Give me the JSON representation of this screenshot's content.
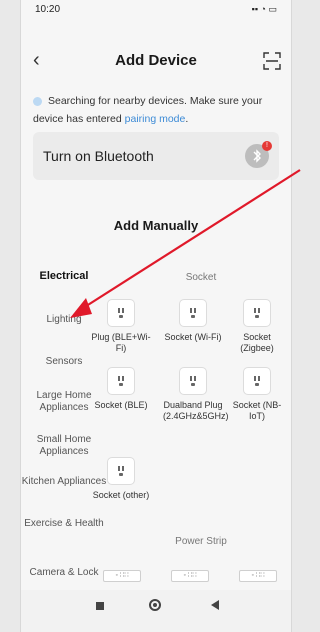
{
  "status": {
    "time": "10:20",
    "right": "▪▪ ◔ ▭"
  },
  "header": {
    "title": "Add Device",
    "back_icon": "chevron-left-icon",
    "scan_icon": "scan-icon"
  },
  "searching": {
    "text": "Searching for nearby devices. Make sure your device has entered",
    "link": "pairing mode",
    "suffix": "."
  },
  "bluetooth": {
    "label": "Turn on Bluetooth",
    "badge": "!"
  },
  "manual": {
    "title": "Add Manually"
  },
  "categories": [
    {
      "label": "Electrical",
      "active": true
    },
    {
      "label": "Lighting"
    },
    {
      "label": "Sensors"
    },
    {
      "label": "Large Home Appliances"
    },
    {
      "label": "Small Home Appliances"
    },
    {
      "label": "Kitchen Appliances"
    },
    {
      "label": "Exercise & Health"
    },
    {
      "label": "Camera & Lock"
    }
  ],
  "groups": {
    "socket": "Socket",
    "power_strip": "Power Strip"
  },
  "devices": [
    {
      "label": "Plug (BLE+Wi-Fi)"
    },
    {
      "label": "Socket (Wi-Fi)"
    },
    {
      "label": "Socket (Zigbee)"
    },
    {
      "label": "Socket (BLE)"
    },
    {
      "label": "Dualband Plug (2.4GHz&5GHz)"
    },
    {
      "label": "Socket (NB-IoT)"
    },
    {
      "label": "Socket (other)"
    }
  ],
  "strips": [
    {
      "label": "◦ ∷∷"
    },
    {
      "label": "◦ ∷∷"
    },
    {
      "label": "◦ ∷∷"
    }
  ],
  "colors": {
    "link": "#3d8bd6",
    "arrow": "#e0192a"
  }
}
